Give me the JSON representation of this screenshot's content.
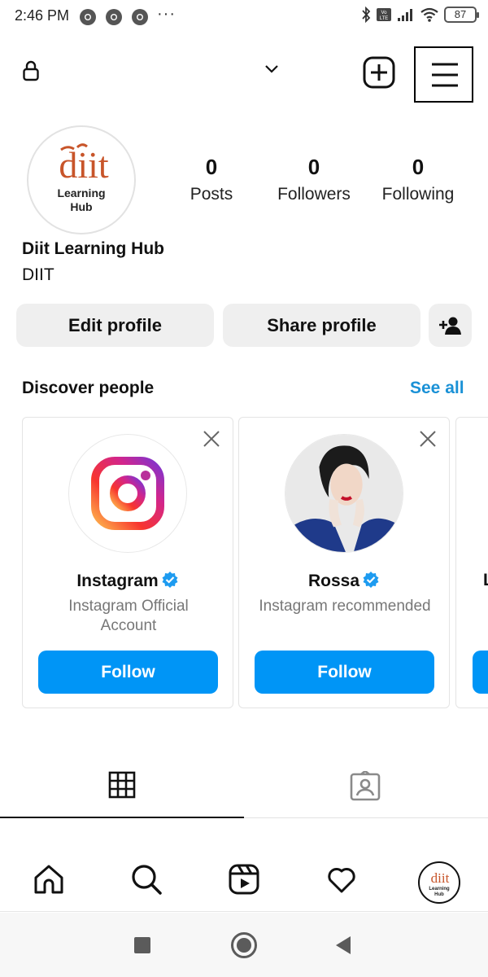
{
  "status_bar": {
    "time": "2:46 PM",
    "battery": "87",
    "dots": "···"
  },
  "profile": {
    "name": "Diit Learning Hub",
    "bio": "DIIT",
    "logo_text": "diit",
    "logo_sub1": "Learning",
    "logo_sub2": "Hub",
    "stats": [
      {
        "value": "0",
        "label": "Posts"
      },
      {
        "value": "0",
        "label": "Followers"
      },
      {
        "value": "0",
        "label": "Following"
      }
    ],
    "buttons": {
      "edit": "Edit profile",
      "share": "Share profile"
    }
  },
  "discover": {
    "title": "Discover people",
    "see_all": "See all",
    "cards": [
      {
        "name": "Instagram",
        "subtitle": "Instagram Official Account",
        "follow": "Follow"
      },
      {
        "name": "Rossa",
        "subtitle": "Instagram recommended",
        "follow": "Follow"
      },
      {
        "name": "L"
      }
    ]
  },
  "colors": {
    "accent": "#0095f6",
    "link": "#1a91d6",
    "logo": "#c8552a"
  },
  "icons": [
    "lock-icon",
    "chevron-down-icon",
    "create-plus-icon",
    "menu-icon",
    "add-person-icon",
    "close-icon",
    "verified-icon",
    "grid-icon",
    "tagged-icon",
    "home-icon",
    "search-icon",
    "reels-icon",
    "heart-icon"
  ]
}
